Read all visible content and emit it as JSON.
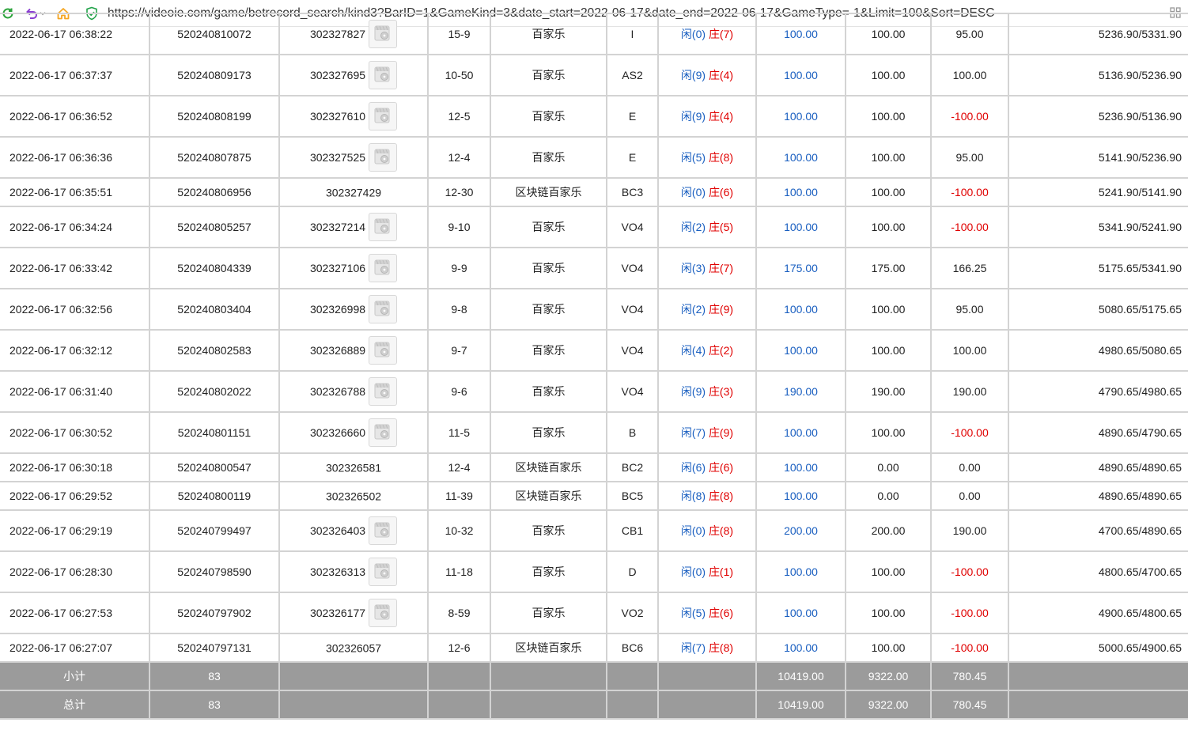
{
  "browser": {
    "url": "https://videoie.com/game/betrecord_search/kind3?BarID=1&GameKind=3&date_start=2022-06-17&date_end=2022-06-17&GameType=-1&Limit=100&Sort=DESC",
    "icons": [
      "refresh-icon",
      "undo-icon",
      "home-icon",
      "shield-icon",
      "grid-icon"
    ],
    "colors": {
      "refresh": "#2aa33a",
      "undo": "#8a3fd1",
      "home": "#f5a623",
      "shield": "#22a34a"
    }
  },
  "table": {
    "rows": [
      {
        "time": "2022-06-17 06:38:22",
        "bet_id": "520240810072",
        "round_id": "302327827",
        "video": true,
        "shoe": "15-9",
        "game": "百家乐",
        "table": "I",
        "result_player": "闲(0)",
        "result_banker": "庄(7)",
        "bet": "100.00",
        "valid": "100.00",
        "win": "95.00",
        "win_negative": false,
        "balance": "5236.90/5331.90"
      },
      {
        "time": "2022-06-17 06:37:37",
        "bet_id": "520240809173",
        "round_id": "302327695",
        "video": true,
        "shoe": "10-50",
        "game": "百家乐",
        "table": "AS2",
        "result_player": "闲(9)",
        "result_banker": "庄(4)",
        "bet": "100.00",
        "valid": "100.00",
        "win": "100.00",
        "win_negative": false,
        "balance": "5136.90/5236.90"
      },
      {
        "time": "2022-06-17 06:36:52",
        "bet_id": "520240808199",
        "round_id": "302327610",
        "video": true,
        "shoe": "12-5",
        "game": "百家乐",
        "table": "E",
        "result_player": "闲(9)",
        "result_banker": "庄(4)",
        "bet": "100.00",
        "valid": "100.00",
        "win": "-100.00",
        "win_negative": true,
        "balance": "5236.90/5136.90"
      },
      {
        "time": "2022-06-17 06:36:36",
        "bet_id": "520240807875",
        "round_id": "302327525",
        "video": true,
        "shoe": "12-4",
        "game": "百家乐",
        "table": "E",
        "result_player": "闲(5)",
        "result_banker": "庄(8)",
        "bet": "100.00",
        "valid": "100.00",
        "win": "95.00",
        "win_negative": false,
        "balance": "5141.90/5236.90"
      },
      {
        "time": "2022-06-17 06:35:51",
        "bet_id": "520240806956",
        "round_id": "302327429",
        "video": false,
        "shoe": "12-30",
        "game": "区块链百家乐",
        "table": "BC3",
        "result_player": "闲(0)",
        "result_banker": "庄(6)",
        "bet": "100.00",
        "valid": "100.00",
        "win": "-100.00",
        "win_negative": true,
        "balance": "5241.90/5141.90"
      },
      {
        "time": "2022-06-17 06:34:24",
        "bet_id": "520240805257",
        "round_id": "302327214",
        "video": true,
        "shoe": "9-10",
        "game": "百家乐",
        "table": "VO4",
        "result_player": "闲(2)",
        "result_banker": "庄(5)",
        "bet": "100.00",
        "valid": "100.00",
        "win": "-100.00",
        "win_negative": true,
        "balance": "5341.90/5241.90"
      },
      {
        "time": "2022-06-17 06:33:42",
        "bet_id": "520240804339",
        "round_id": "302327106",
        "video": true,
        "shoe": "9-9",
        "game": "百家乐",
        "table": "VO4",
        "result_player": "闲(3)",
        "result_banker": "庄(7)",
        "bet": "175.00",
        "valid": "175.00",
        "win": "166.25",
        "win_negative": false,
        "balance": "5175.65/5341.90"
      },
      {
        "time": "2022-06-17 06:32:56",
        "bet_id": "520240803404",
        "round_id": "302326998",
        "video": true,
        "shoe": "9-8",
        "game": "百家乐",
        "table": "VO4",
        "result_player": "闲(2)",
        "result_banker": "庄(9)",
        "bet": "100.00",
        "valid": "100.00",
        "win": "95.00",
        "win_negative": false,
        "balance": "5080.65/5175.65"
      },
      {
        "time": "2022-06-17 06:32:12",
        "bet_id": "520240802583",
        "round_id": "302326889",
        "video": true,
        "shoe": "9-7",
        "game": "百家乐",
        "table": "VO4",
        "result_player": "闲(4)",
        "result_banker": "庄(2)",
        "bet": "100.00",
        "valid": "100.00",
        "win": "100.00",
        "win_negative": false,
        "balance": "4980.65/5080.65"
      },
      {
        "time": "2022-06-17 06:31:40",
        "bet_id": "520240802022",
        "round_id": "302326788",
        "video": true,
        "shoe": "9-6",
        "game": "百家乐",
        "table": "VO4",
        "result_player": "闲(9)",
        "result_banker": "庄(3)",
        "bet": "190.00",
        "valid": "190.00",
        "win": "190.00",
        "win_negative": false,
        "balance": "4790.65/4980.65"
      },
      {
        "time": "2022-06-17 06:30:52",
        "bet_id": "520240801151",
        "round_id": "302326660",
        "video": true,
        "shoe": "11-5",
        "game": "百家乐",
        "table": "B",
        "result_player": "闲(7)",
        "result_banker": "庄(9)",
        "bet": "100.00",
        "valid": "100.00",
        "win": "-100.00",
        "win_negative": true,
        "balance": "4890.65/4790.65"
      },
      {
        "time": "2022-06-17 06:30:18",
        "bet_id": "520240800547",
        "round_id": "302326581",
        "video": false,
        "shoe": "12-4",
        "game": "区块链百家乐",
        "table": "BC2",
        "result_player": "闲(6)",
        "result_banker": "庄(6)",
        "bet": "100.00",
        "valid": "0.00",
        "win": "0.00",
        "win_negative": false,
        "balance": "4890.65/4890.65"
      },
      {
        "time": "2022-06-17 06:29:52",
        "bet_id": "520240800119",
        "round_id": "302326502",
        "video": false,
        "shoe": "11-39",
        "game": "区块链百家乐",
        "table": "BC5",
        "result_player": "闲(8)",
        "result_banker": "庄(8)",
        "bet": "100.00",
        "valid": "0.00",
        "win": "0.00",
        "win_negative": false,
        "balance": "4890.65/4890.65"
      },
      {
        "time": "2022-06-17 06:29:19",
        "bet_id": "520240799497",
        "round_id": "302326403",
        "video": true,
        "shoe": "10-32",
        "game": "百家乐",
        "table": "CB1",
        "result_player": "闲(0)",
        "result_banker": "庄(8)",
        "bet": "200.00",
        "valid": "200.00",
        "win": "190.00",
        "win_negative": false,
        "balance": "4700.65/4890.65"
      },
      {
        "time": "2022-06-17 06:28:30",
        "bet_id": "520240798590",
        "round_id": "302326313",
        "video": true,
        "shoe": "11-18",
        "game": "百家乐",
        "table": "D",
        "result_player": "闲(0)",
        "result_banker": "庄(1)",
        "bet": "100.00",
        "valid": "100.00",
        "win": "-100.00",
        "win_negative": true,
        "balance": "4800.65/4700.65"
      },
      {
        "time": "2022-06-17 06:27:53",
        "bet_id": "520240797902",
        "round_id": "302326177",
        "video": true,
        "shoe": "8-59",
        "game": "百家乐",
        "table": "VO2",
        "result_player": "闲(5)",
        "result_banker": "庄(6)",
        "bet": "100.00",
        "valid": "100.00",
        "win": "-100.00",
        "win_negative": true,
        "balance": "4900.65/4800.65"
      },
      {
        "time": "2022-06-17 06:27:07",
        "bet_id": "520240797131",
        "round_id": "302326057",
        "video": false,
        "shoe": "12-6",
        "game": "区块链百家乐",
        "table": "BC6",
        "result_player": "闲(7)",
        "result_banker": "庄(8)",
        "bet": "100.00",
        "valid": "100.00",
        "win": "-100.00",
        "win_negative": true,
        "balance": "5000.65/4900.65"
      }
    ],
    "summary": [
      {
        "label": "小计",
        "count": "83",
        "bet": "10419.00",
        "valid": "9322.00",
        "win": "780.45"
      },
      {
        "label": "总计",
        "count": "83",
        "bet": "10419.00",
        "valid": "9322.00",
        "win": "780.45"
      }
    ]
  }
}
